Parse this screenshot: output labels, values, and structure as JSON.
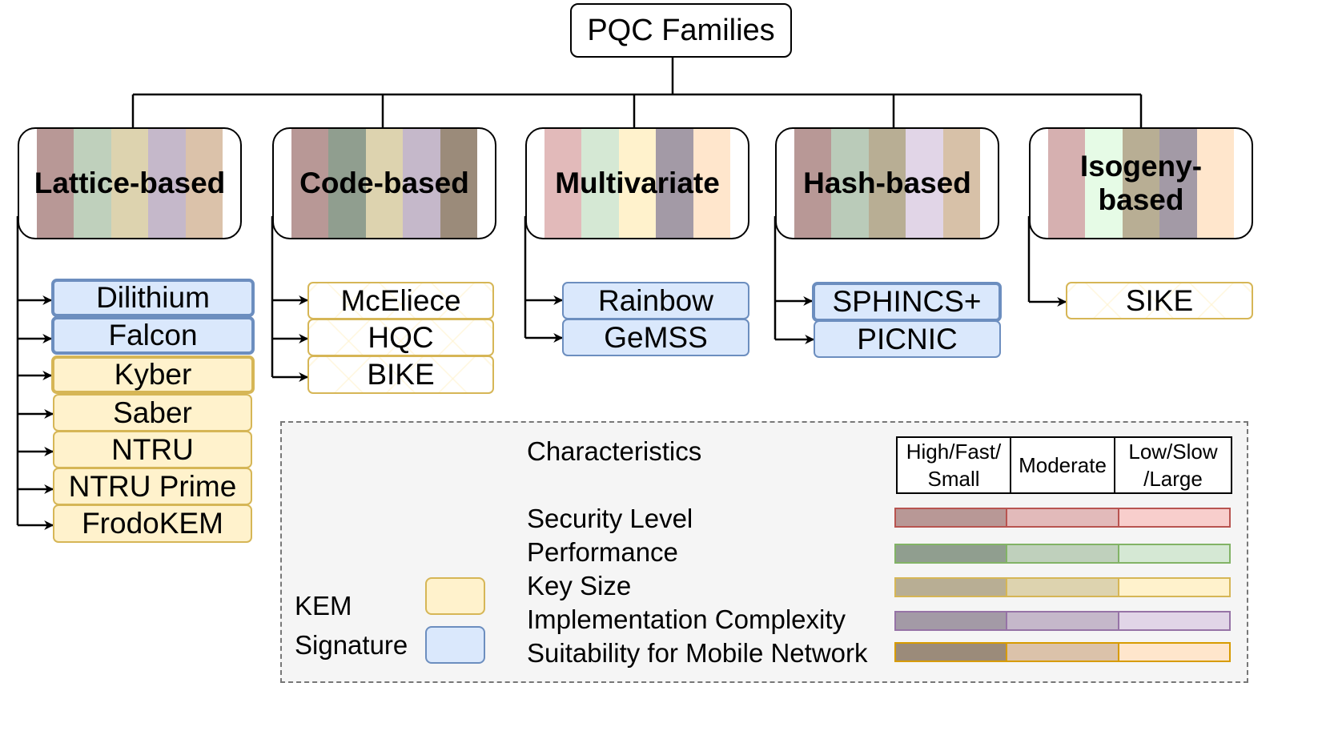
{
  "root": {
    "label": "PQC Families"
  },
  "colors": {
    "kem_fill": "#fff2cc",
    "kem_border": "#d6b656",
    "sig_fill": "#dae8fc",
    "sig_border": "#6c8ebf",
    "legend_bg": "#f5f5f5"
  },
  "characteristics": {
    "title": "Characteristics",
    "levels": [
      "High/Fast/ Small",
      "Moderate",
      "Low/Slow /Large"
    ],
    "rows": [
      {
        "label": "Security Level",
        "border": "#b85450",
        "colors": [
          "#b89896",
          "#e2baba",
          "#f8cecc"
        ]
      },
      {
        "label": "Performance",
        "border": "#82b366",
        "colors": [
          "#909e8f",
          "#bfd0bc",
          "#d5e8d4"
        ]
      },
      {
        "label": "Key Size",
        "border": "#d6b656",
        "colors": [
          "#b8ae94",
          "#ddd3af",
          "#fff2cc"
        ]
      },
      {
        "label": "Implementation Complexity",
        "border": "#9673a6",
        "colors": [
          "#a39aa6",
          "#c5b8ca",
          "#e1d5e7"
        ]
      },
      {
        "label": "Suitability for Mobile Network",
        "border": "#d79b00",
        "colors": [
          "#9b8b7a",
          "#dbc2aa",
          "#ffe6cc"
        ]
      }
    ]
  },
  "algorithm_types": {
    "kem_label": "KEM",
    "signature_label": "Signature"
  },
  "families": [
    {
      "name": "Lattice-based",
      "levels": [
        "high",
        "moderate",
        "moderate",
        "moderate",
        "moderate"
      ],
      "stripes": [
        "#b89896",
        "#bfd0bc",
        "#ddd3af",
        "#c5b8ca",
        "#dbc2aa"
      ],
      "algorithms": [
        {
          "name": "Dilithium",
          "type": "Signature",
          "selected": true
        },
        {
          "name": "Falcon",
          "type": "Signature",
          "selected": true
        },
        {
          "name": "Kyber",
          "type": "KEM",
          "selected": true
        },
        {
          "name": "Saber",
          "type": "KEM",
          "selected": false
        },
        {
          "name": "NTRU",
          "type": "KEM",
          "selected": false
        },
        {
          "name": "NTRU Prime",
          "type": "KEM",
          "selected": false
        },
        {
          "name": "FrodoKEM",
          "type": "KEM",
          "selected": false
        }
      ]
    },
    {
      "name": "Code-based",
      "levels": [
        "high",
        "high",
        "moderate",
        "moderate",
        "high"
      ],
      "stripes": [
        "#b89896",
        "#909e8f",
        "#ddd3af",
        "#c5b8ca",
        "#9b8b7a"
      ],
      "algorithms": [
        {
          "name": "McEliece",
          "type": "KEM",
          "selected": false
        },
        {
          "name": "HQC",
          "type": "KEM",
          "selected": false
        },
        {
          "name": "BIKE",
          "type": "KEM",
          "selected": false
        }
      ]
    },
    {
      "name": "Multivariate",
      "levels": [
        "moderate",
        "low",
        "low",
        "high",
        "low"
      ],
      "stripes": [
        "#e2baba",
        "#d5e8d4",
        "#fff2cc",
        "#a39aa6",
        "#ffe6cc"
      ],
      "algorithms": [
        {
          "name": "Rainbow",
          "type": "Signature",
          "selected": false
        },
        {
          "name": "GeMSS",
          "type": "Signature",
          "selected": false
        }
      ]
    },
    {
      "name": "Hash-based",
      "levels": [
        "high",
        "moderate",
        "high",
        "low",
        "moderate"
      ],
      "stripes": [
        "#b89896",
        "#bacbb9",
        "#b8ae94",
        "#e1d5e7",
        "#d7c1a8"
      ],
      "algorithms": [
        {
          "name": "SPHINCS+",
          "type": "Signature",
          "selected": true
        },
        {
          "name": "PICNIC",
          "type": "Signature",
          "selected": false
        }
      ]
    },
    {
      "name": "Isogeny-based",
      "levels": [
        "moderate",
        "low",
        "high",
        "high",
        "low"
      ],
      "stripes": [
        "#d6b0b0",
        "#e6fbe6",
        "#b8ae94",
        "#a39aa6",
        "#ffe6cc"
      ],
      "algorithms": [
        {
          "name": "SIKE",
          "type": "KEM",
          "selected": false
        }
      ]
    }
  ]
}
